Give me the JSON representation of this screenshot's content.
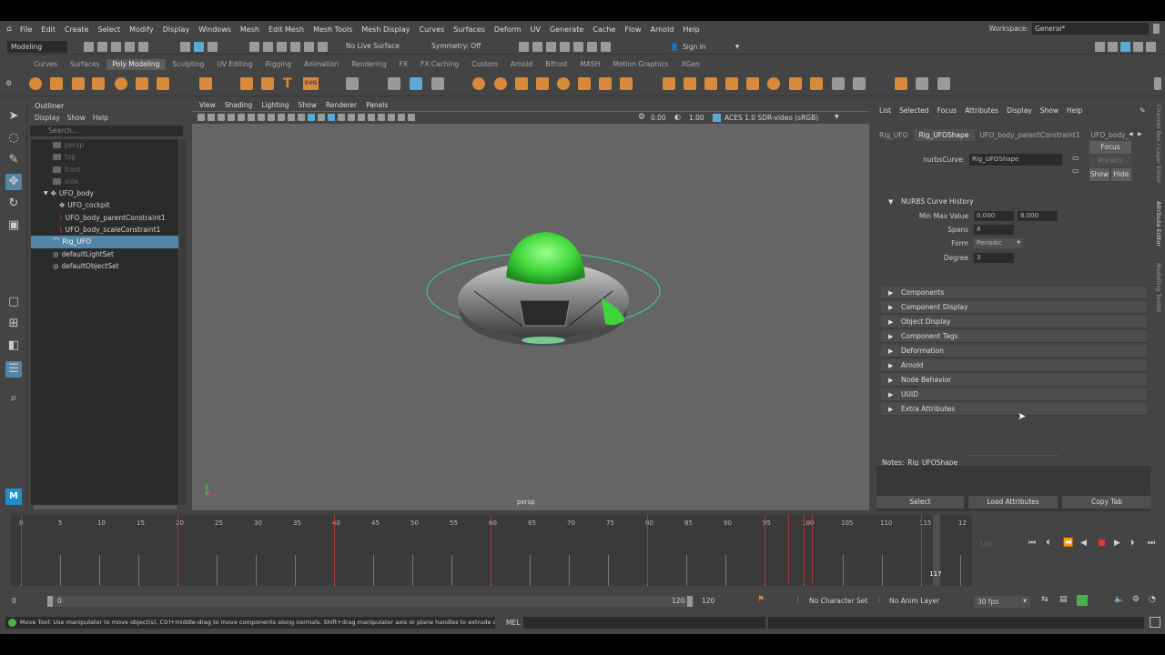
{
  "menubar": {
    "items": [
      "File",
      "Edit",
      "Create",
      "Select",
      "Modify",
      "Display",
      "Windows",
      "Mesh",
      "Edit Mesh",
      "Mesh Tools",
      "Mesh Display",
      "Curves",
      "Surfaces",
      "Deform",
      "UV",
      "Generate",
      "Cache",
      "Flow",
      "Arnold",
      "Help"
    ],
    "workspace_label": "Workspace:",
    "workspace_value": "General*"
  },
  "statusline": {
    "mode": "Modeling",
    "live_surface": "No Live Surface",
    "symmetry": "Symmetry: Off",
    "sign_in": "Sign In"
  },
  "shelf": {
    "tabs": [
      "Curves",
      "Surfaces",
      "Poly Modeling",
      "Sculpting",
      "UV Editing",
      "Rigging",
      "Animation",
      "Rendering",
      "FX",
      "FX Caching",
      "Custom",
      "Arnold",
      "Bifrost",
      "MASH",
      "Motion Graphics",
      "XGen"
    ],
    "active_tab": "Poly Modeling",
    "svg_label": "SVG"
  },
  "outliner": {
    "title": "Outliner",
    "menu": [
      "Display",
      "Show",
      "Help"
    ],
    "search_placeholder": "Search...",
    "items": [
      {
        "label": "persp",
        "kind": "camera"
      },
      {
        "label": "top",
        "kind": "camera"
      },
      {
        "label": "front",
        "kind": "camera"
      },
      {
        "label": "side",
        "kind": "camera"
      },
      {
        "label": "UFO_body",
        "kind": "transform"
      },
      {
        "label": "UFO_cockpit",
        "kind": "transform"
      },
      {
        "label": "UFO_body_parentConstraint1",
        "kind": "constraint"
      },
      {
        "label": "UFO_body_scaleConstraint1",
        "kind": "constraint"
      },
      {
        "label": "Rig_UFO",
        "kind": "curve",
        "selected": true
      },
      {
        "label": "defaultLightSet",
        "kind": "set"
      },
      {
        "label": "defaultObjectSet",
        "kind": "set"
      }
    ]
  },
  "viewport": {
    "menu": [
      "View",
      "Shading",
      "Lighting",
      "Show",
      "Renderer",
      "Panels"
    ],
    "exposure": "0.00",
    "gamma": "1.00",
    "colorspace": "ACES 1.0 SDR-video (sRGB)",
    "camera_label": "persp"
  },
  "attribute_editor": {
    "menu": [
      "List",
      "Selected",
      "Focus",
      "Attributes",
      "Display",
      "Show",
      "Help"
    ],
    "tabs": [
      "Rig_UFO",
      "Rig_UFOShape",
      "UFO_body_parentConstraint1",
      "UFO_body_"
    ],
    "active_tab": "Rig_UFOShape",
    "node_label": "nurbsCurve:",
    "node_value": "Rig_UFOShape",
    "focus_button": "Focus",
    "presets_button": "Presets",
    "show_button": "Show",
    "hide_button": "Hide",
    "history_section": "NURBS Curve History",
    "min_max_label": "Min Max Value",
    "min_value": "0.000",
    "max_value": "8.000",
    "spans_label": "Spans",
    "spans_value": "8",
    "form_label": "Form",
    "form_value": "Periodic",
    "degree_label": "Degree",
    "degree_value": "3",
    "sections": [
      "Components",
      "Component Display",
      "Object Display",
      "Component Tags",
      "Deformation",
      "Arnold",
      "Node Behavior",
      "UUID",
      "Extra Attributes"
    ],
    "notes_label": "Notes:",
    "notes_node": "Rig_UFOShape",
    "bottom_buttons": [
      "Select",
      "Load Attributes",
      "Copy Tab"
    ]
  },
  "side_labels": [
    "Channel Box / Layer Editor",
    "Attribute Editor",
    "Modelling Toolkit"
  ],
  "timeslider": {
    "ticks": [
      "0",
      "5",
      "10",
      "15",
      "20",
      "25",
      "30",
      "35",
      "40",
      "45",
      "50",
      "55",
      "60",
      "65",
      "70",
      "75",
      "80",
      "85",
      "90",
      "95",
      "100",
      "105",
      "110",
      "115",
      "12"
    ],
    "current_frame": "117",
    "current_frame_value": 117,
    "range_max_display": "120",
    "keyframes": [
      0,
      20,
      40,
      60,
      80,
      95,
      98,
      100,
      101,
      115,
      117
    ]
  },
  "rangeslider": {
    "start": "0",
    "inner_start": "0",
    "inner_end": "120",
    "end": "120",
    "character_set": "No Character Set",
    "anim_layer": "No Anim Layer",
    "fps": "30 fps"
  },
  "cmdline": {
    "help_text": "Move Tool: Use manipulator to move object(s). Ctrl+middle-drag to move components along normals. Shift+drag manipulator axis or plane handles to extrude components or c",
    "lang": "MEL"
  },
  "colors": {
    "selection": "#5285a6",
    "shelf_icon": "#d88a3a",
    "keyframe": "#a63a3a",
    "ufo_glow": "#55e04a",
    "viewport_bg": "#656565"
  }
}
